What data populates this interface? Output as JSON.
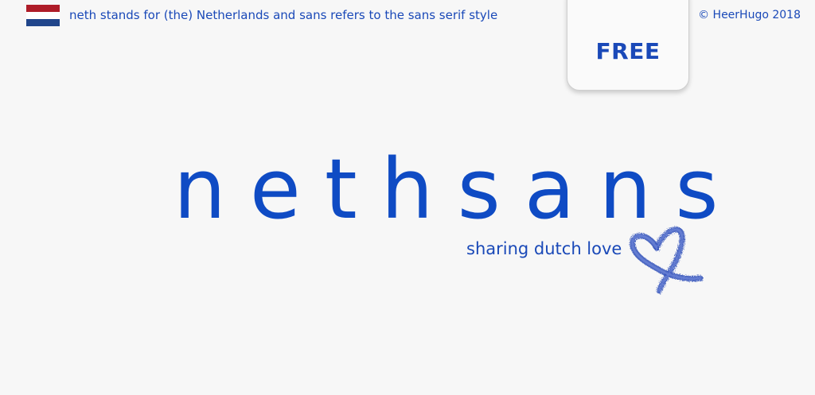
{
  "header": {
    "tagline": "neth stands for (the) Netherlands and sans refers to the sans serif style",
    "copyright": "© HeerHugo 2018"
  },
  "badge": {
    "label": "FREE"
  },
  "hero": {
    "title": "nethsans",
    "subtitle": "sharing dutch love"
  },
  "icons": {
    "flag": "netherlands-flag-icon",
    "heart": "heart-ribbon-icon"
  },
  "colors": {
    "brand_blue": "#0f4bc4",
    "text_blue": "#1a49b8",
    "flag_red": "#ae1c28",
    "flag_white": "#ffffff",
    "flag_blue": "#21468b",
    "background": "#f7f7f7"
  }
}
